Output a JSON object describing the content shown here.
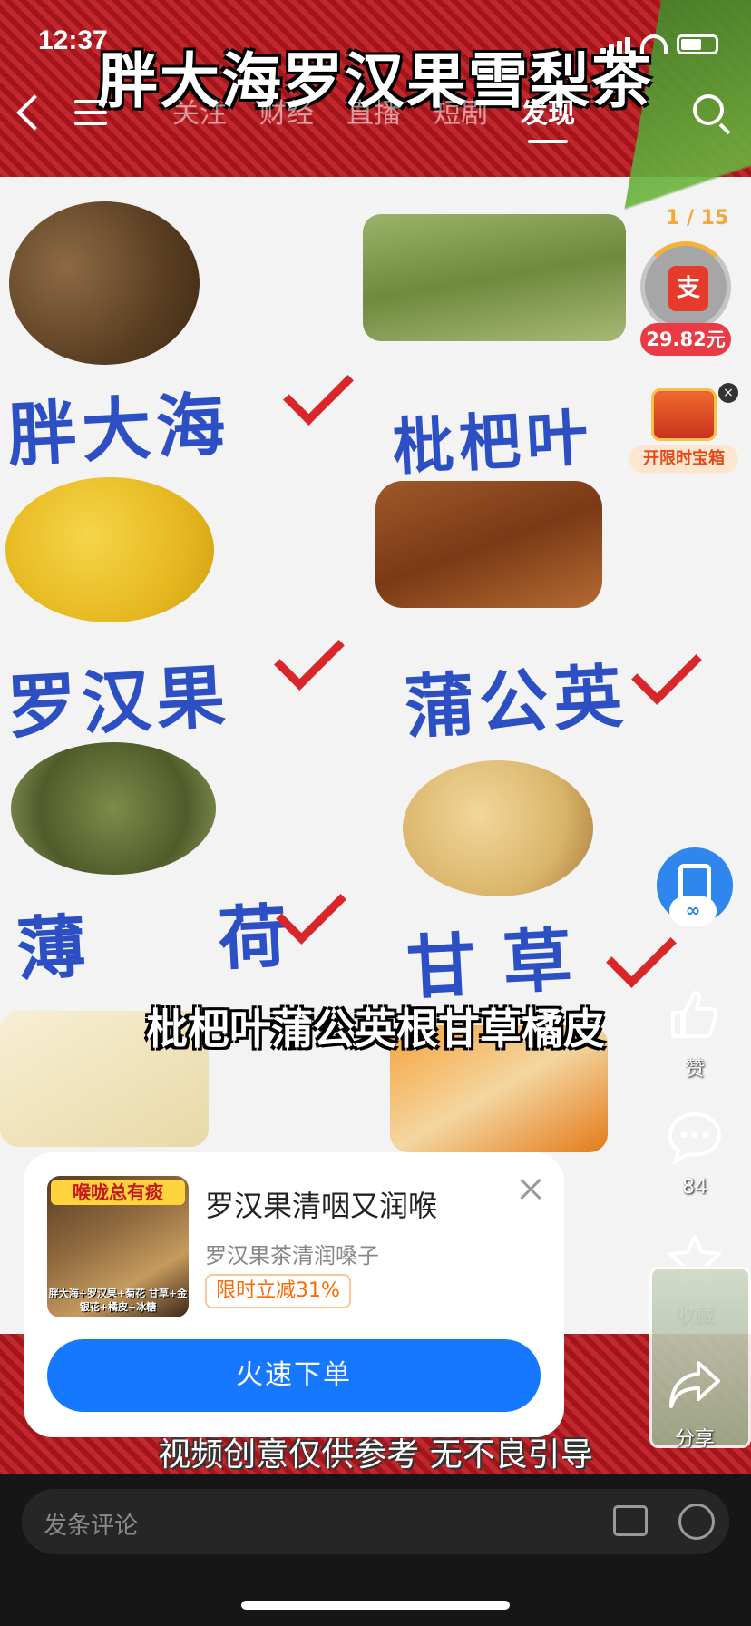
{
  "status_bar": {
    "time": "12:37"
  },
  "nav": {
    "tabs": [
      {
        "label": "关注",
        "active": false
      },
      {
        "label": "财经",
        "active": false
      },
      {
        "label": "直播",
        "active": false
      },
      {
        "label": "短剧",
        "active": false
      },
      {
        "label": "发现",
        "active": true
      }
    ]
  },
  "video": {
    "title_overlay": "胖大海罗汉果雪梨茶",
    "handwritten": [
      "胖大海",
      "枇杷叶",
      "罗汉果",
      "蒲公英",
      "薄 荷",
      "甘草"
    ],
    "subtitle": "枇杷叶蒲公英根甘草橘皮",
    "disclaimer": "视频创意仅供参考 无不良引导"
  },
  "reward": {
    "progress": "1 / 15",
    "icon_text": "支",
    "amount": "29.82元",
    "treasure_label": "开限时宝箱",
    "treasure_close": "×"
  },
  "actions": {
    "like": {
      "icon": "thumbs-up-icon",
      "label": "赞"
    },
    "comment": {
      "icon": "comment-icon",
      "count": "84"
    },
    "favorite": {
      "icon": "star-icon",
      "label": "收藏"
    },
    "share": {
      "icon": "share-icon",
      "label": "分享"
    }
  },
  "product_card": {
    "thumb_headline": "喉咙总有痰",
    "thumb_caption": "胖大海+罗汉果+菊花 甘草+金银花+橘皮+冰糖",
    "title": "罗汉果清咽又润喉",
    "description": "罗汉果茶清润嗓子",
    "promo": "限时立减31%",
    "buy_label": "火速下单"
  },
  "comment_bar": {
    "placeholder": "发条评论"
  },
  "colors": {
    "accent_blue": "#1677ff",
    "promo_orange": "#ff6a00",
    "reward_red": "#e93a46"
  }
}
